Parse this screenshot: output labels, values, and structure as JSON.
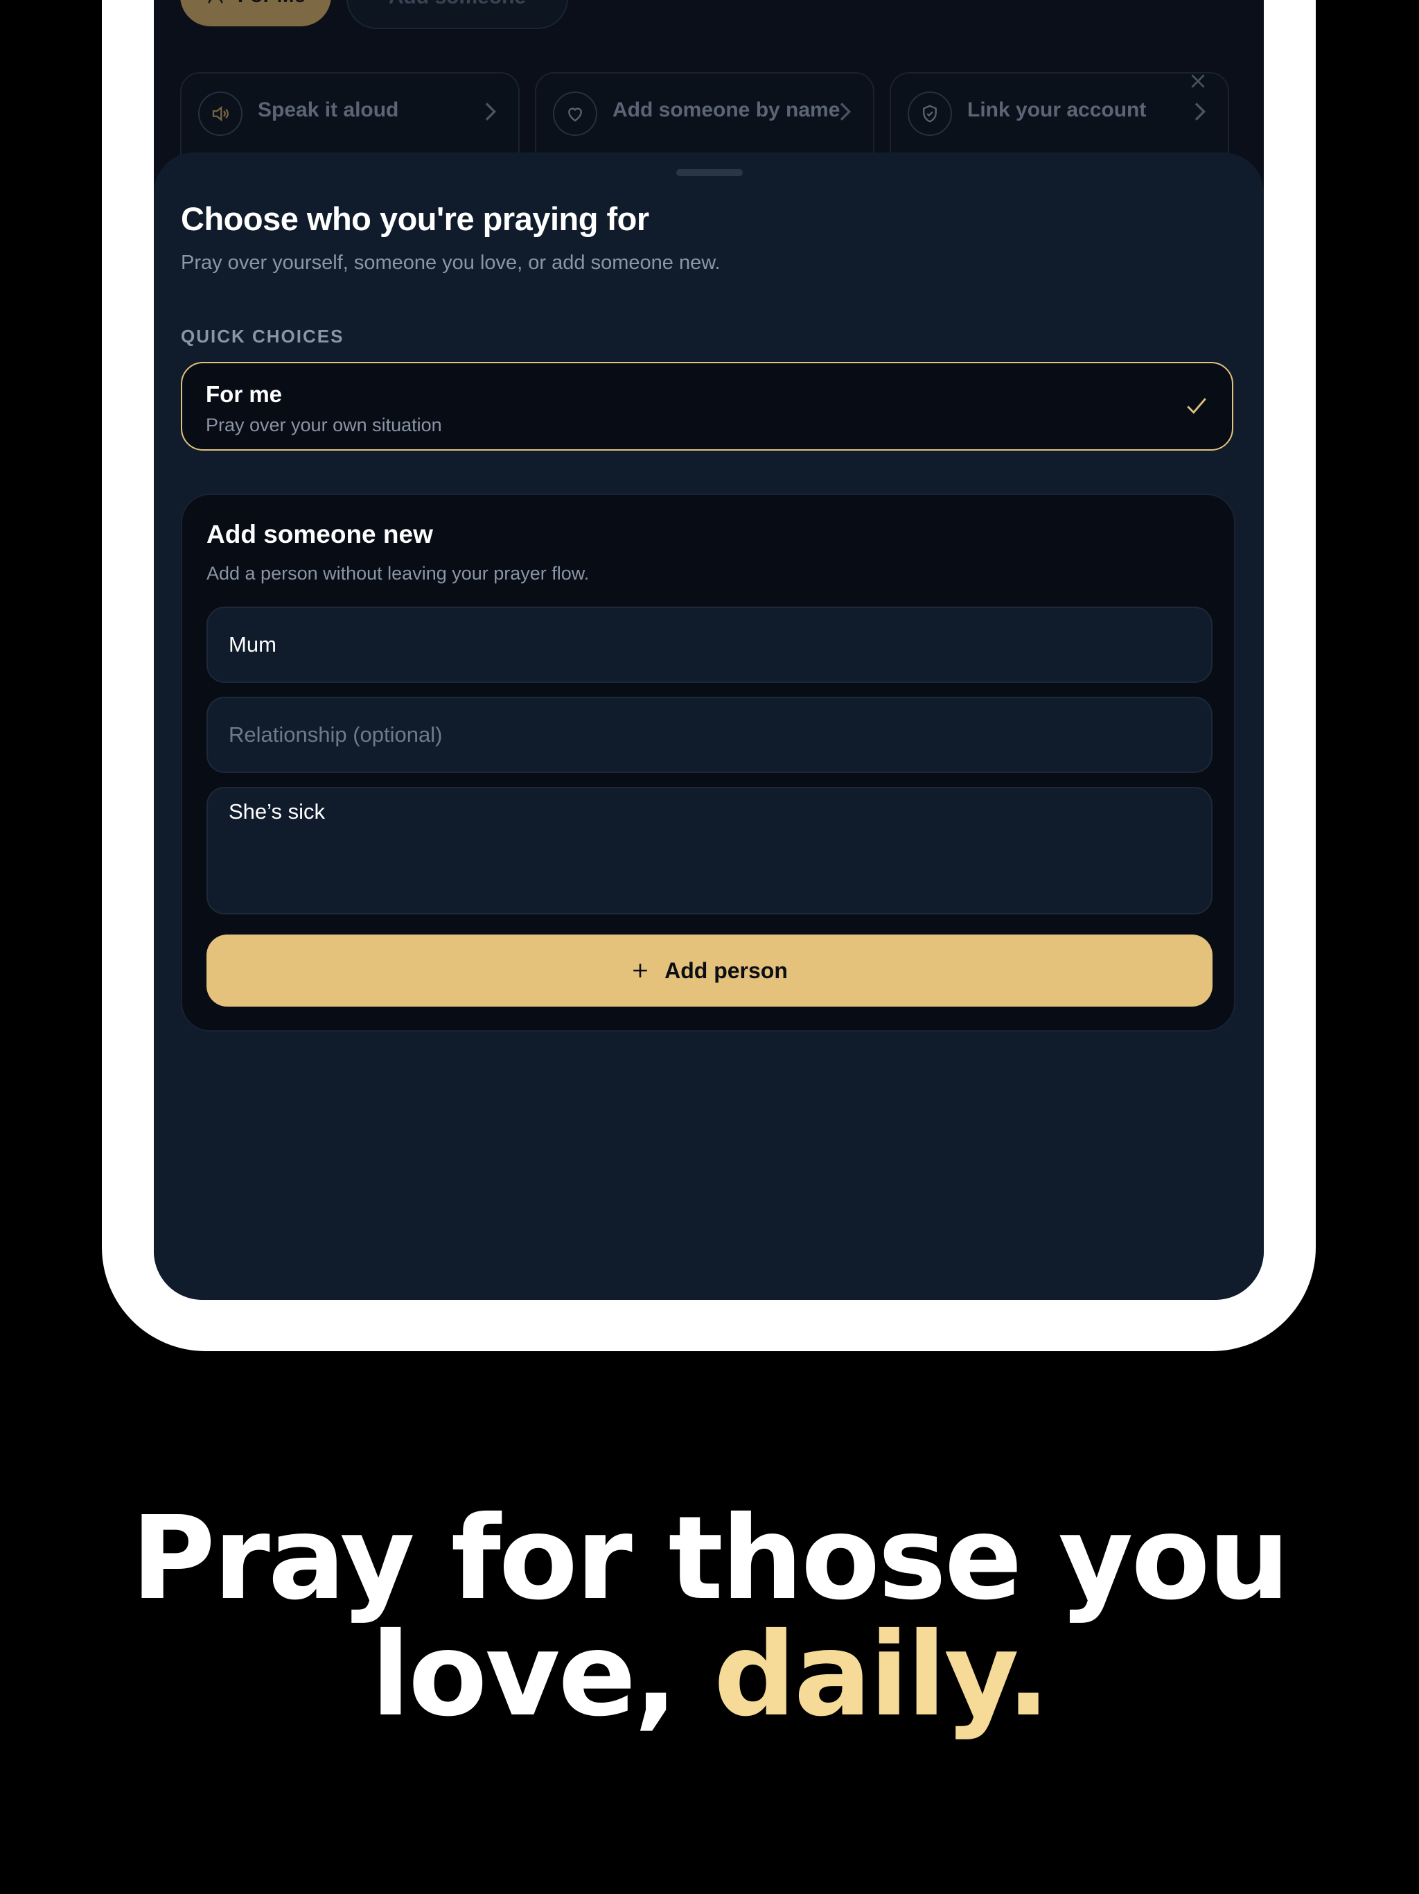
{
  "background": {
    "pills": [
      "For Me",
      "Add someone"
    ],
    "cards": [
      {
        "label": "Speak it aloud",
        "icon": "speaker-icon"
      },
      {
        "label": "Add someone by name",
        "icon": "heart-icon"
      },
      {
        "label": "Link your account",
        "icon": "shield-check-icon"
      }
    ]
  },
  "sheet": {
    "title": "Choose who you're praying for",
    "subtitle": "Pray over yourself, someone you love, or add someone new.",
    "quick_label": "QUICK CHOICES",
    "choice": {
      "title": "For me",
      "subtitle": "Pray over your own situation",
      "selected": true
    },
    "add_section": {
      "title": "Add someone new",
      "subtitle": "Add a person without leaving your prayer flow.",
      "name_value": "Mum",
      "relationship_placeholder": "Relationship (optional)",
      "note_value": "She’s sick",
      "button_label": "Add person"
    }
  },
  "headline": {
    "line1": "Pray for those you",
    "line2_prefix": "love, ",
    "line2_accent": "daily."
  },
  "colors": {
    "accent": "#e4c27c",
    "headline_accent": "#f6da98",
    "sheet_bg": "#101b2b"
  }
}
